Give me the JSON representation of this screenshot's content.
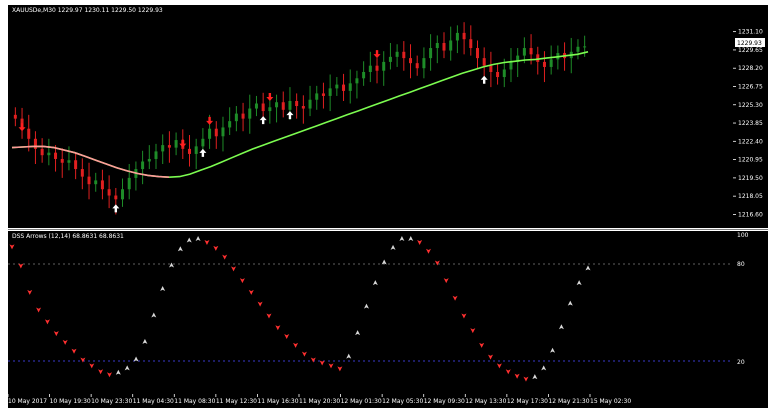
{
  "main_chart": {
    "header": "XAUUSDe,M30  1229.97 1230.11 1229.50 1229.93",
    "current_price": "1229.93",
    "price_ticks": [
      "1231.10",
      "1229.65",
      "1228.20",
      "1226.75",
      "1225.30",
      "1223.85",
      "1222.40",
      "1220.95",
      "1219.50",
      "1218.05",
      "1216.60"
    ],
    "price_range": [
      1216.0,
      1232.5
    ],
    "candles": [
      1224.2,
      1223.4,
      1222.6,
      1221.8,
      1221.3,
      1221.5,
      1221.0,
      1220.7,
      1220.9,
      1220.2,
      1219.6,
      1219.0,
      1219.3,
      1218.6,
      1218.1,
      1217.8,
      1218.6,
      1219.5,
      1220.2,
      1220.8,
      1221.0,
      1221.6,
      1222.1,
      1221.9,
      1222.5,
      1221.8,
      1221.4,
      1222.0,
      1222.6,
      1223.4,
      1222.8,
      1223.5,
      1224.0,
      1224.6,
      1224.2,
      1225.0,
      1225.4,
      1224.8,
      1225.1,
      1225.5,
      1224.9,
      1225.6,
      1225.2,
      1225.0,
      1225.7,
      1226.2,
      1226.0,
      1226.6,
      1226.9,
      1226.4,
      1227.0,
      1227.4,
      1227.9,
      1228.4,
      1228.0,
      1228.7,
      1229.1,
      1229.5,
      1229.0,
      1228.6,
      1228.2,
      1229.0,
      1229.8,
      1230.2,
      1229.6,
      1230.4,
      1231.0,
      1230.5,
      1229.8,
      1229.0,
      1228.4,
      1227.9,
      1227.5,
      1228.1,
      1228.7,
      1229.2,
      1229.8,
      1229.3,
      1228.7,
      1228.3,
      1228.9,
      1229.4,
      1229.0,
      1229.5,
      1229.9,
      1229.93
    ],
    "ma_line": [
      1221.9,
      1221.95,
      1222.0,
      1222.0,
      1221.9,
      1221.7,
      1221.5,
      1221.2,
      1220.9,
      1220.6,
      1220.3,
      1220.05,
      1219.85,
      1219.7,
      1219.6,
      1219.55,
      1219.6,
      1219.8,
      1220.1,
      1220.4,
      1220.75,
      1221.1,
      1221.45,
      1221.8,
      1222.1,
      1222.4,
      1222.7,
      1223.0,
      1223.3,
      1223.6,
      1223.9,
      1224.2,
      1224.5,
      1224.8,
      1225.1,
      1225.4,
      1225.7,
      1226.0,
      1226.3,
      1226.6,
      1226.9,
      1227.2,
      1227.5,
      1227.8,
      1228.05,
      1228.3,
      1228.5,
      1228.65,
      1228.75,
      1228.85,
      1228.9,
      1229.0,
      1229.1,
      1229.2,
      1229.3,
      1229.5
    ],
    "signal_arrows": [
      {
        "dir": "down",
        "bar": 1,
        "price": 1223.6
      },
      {
        "dir": "up",
        "bar": 15,
        "price": 1217.0
      },
      {
        "dir": "down",
        "bar": 25,
        "price": 1222.3
      },
      {
        "dir": "up",
        "bar": 28,
        "price": 1221.4
      },
      {
        "dir": "down",
        "bar": 29,
        "price": 1224.1
      },
      {
        "dir": "up",
        "bar": 37,
        "price": 1224.0
      },
      {
        "dir": "down",
        "bar": 38,
        "price": 1226.0
      },
      {
        "dir": "up",
        "bar": 41,
        "price": 1224.4
      },
      {
        "dir": "down",
        "bar": 54,
        "price": 1229.4
      },
      {
        "dir": "up",
        "bar": 70,
        "price": 1227.2
      }
    ]
  },
  "indicator": {
    "header": "DSS Arrows (12,14) 68.8631 68.8631",
    "levels": [
      "100",
      "80",
      "20"
    ],
    "range": [
      0,
      100
    ],
    "values": [
      95,
      82,
      64,
      52,
      44,
      36,
      30,
      24,
      18,
      14,
      10,
      8,
      9,
      12,
      18,
      30,
      48,
      66,
      82,
      93,
      99,
      100,
      98,
      94,
      88,
      80,
      72,
      64,
      56,
      48,
      40,
      34,
      28,
      22,
      18,
      16,
      14,
      12,
      20,
      36,
      54,
      70,
      84,
      94,
      100,
      100,
      98,
      92,
      84,
      72,
      60,
      48,
      38,
      28,
      20,
      14,
      10,
      7,
      5,
      6,
      12,
      24,
      40,
      56,
      70,
      80
    ]
  },
  "time_axis": [
    "10 May 2017",
    "10 May 19:30",
    "10 May 23:30",
    "11 May 04:30",
    "11 May 08:30",
    "11 May 12:30",
    "11 May 16:30",
    "11 May 20:30",
    "12 May 01:30",
    "12 May 05:30",
    "12 May 09:30",
    "12 May 13:30",
    "12 May 17:30",
    "12 May 21:30",
    "15 May 02:30"
  ],
  "colors": {
    "background": "#000000",
    "bull_candle": "#1e8c28",
    "bear_candle": "#e02020",
    "ma_up": "#7cfc50",
    "ma_down": "#ff9a9a",
    "arrow_up": "#ffffff",
    "arrow_down": "#ff2020",
    "dss_up": "#d8d8d8",
    "dss_down": "#ff3030",
    "level_80": "#606060",
    "level_20": "#3a3acc"
  }
}
